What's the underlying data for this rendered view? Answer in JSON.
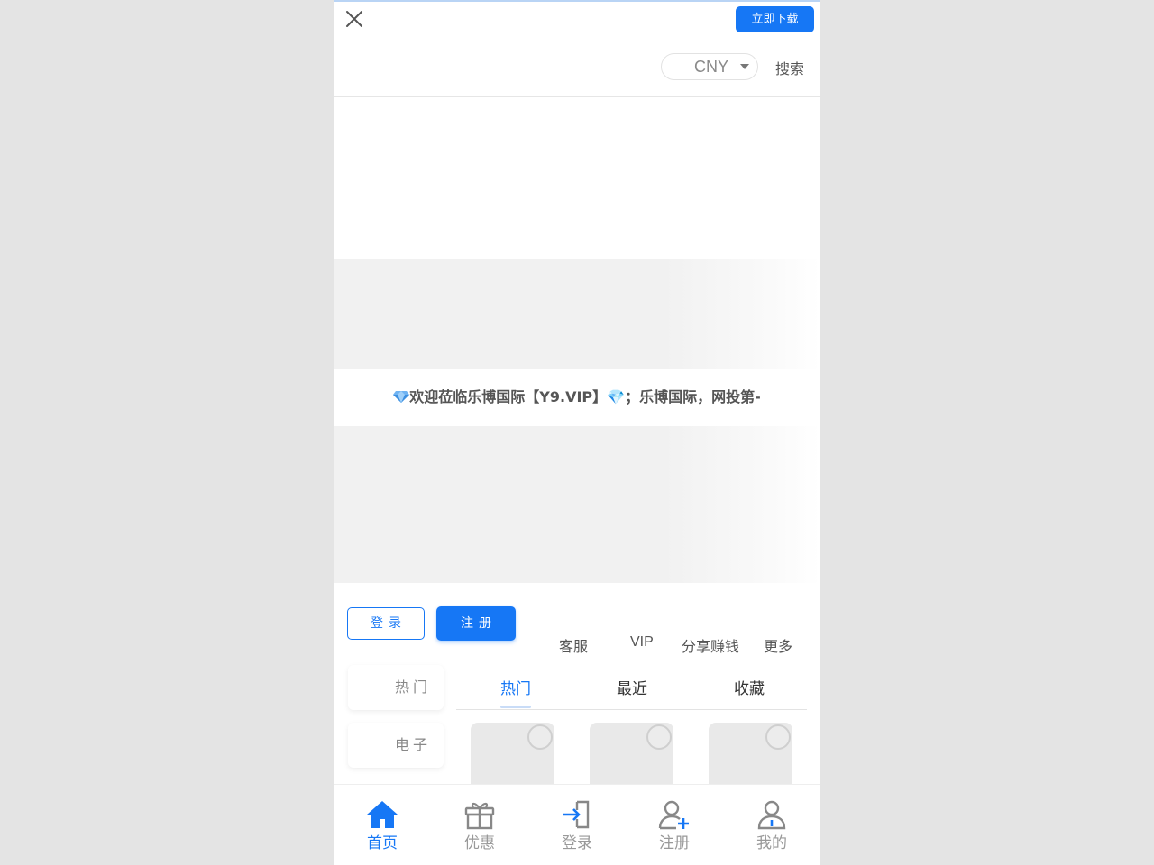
{
  "header": {
    "download_label": "立即下载",
    "currency": "CNY",
    "search_label": "搜索"
  },
  "notice": {
    "text": "欢迎莅临乐博国际【Y9.VIP】💎；乐博国际，网投第-"
  },
  "auth": {
    "login_label": "登录",
    "register_label": "注册"
  },
  "quick_links": [
    {
      "label": "客服"
    },
    {
      "label": "VIP"
    },
    {
      "label": "分享赚钱"
    },
    {
      "label": "更多"
    }
  ],
  "side_tabs": [
    {
      "label": "热门"
    },
    {
      "label": "电子"
    }
  ],
  "game_tabs": [
    {
      "label": "热门",
      "active": true
    },
    {
      "label": "最近"
    },
    {
      "label": "收藏"
    }
  ],
  "bottom_nav": [
    {
      "label": "首页",
      "icon": "home-icon",
      "active": true
    },
    {
      "label": "优惠",
      "icon": "gift-icon"
    },
    {
      "label": "登录",
      "icon": "login-icon"
    },
    {
      "label": "注册",
      "icon": "add-user-icon"
    },
    {
      "label": "我的",
      "icon": "profile-icon"
    }
  ],
  "colors": {
    "accent": "#1677f5",
    "inactive": "#999999",
    "background": "#e4e4e4"
  }
}
